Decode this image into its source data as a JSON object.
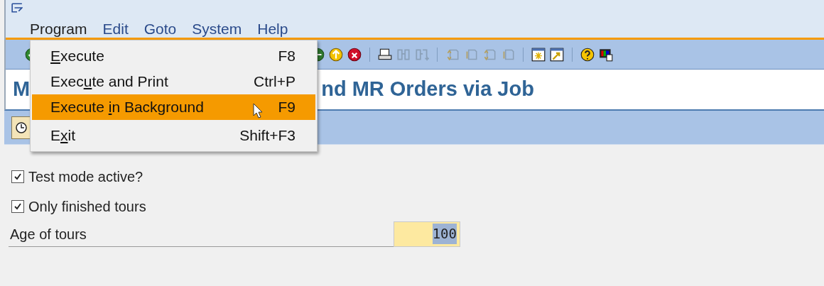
{
  "menubar": [
    {
      "label": "Program",
      "selected": true
    },
    {
      "label": "Edit",
      "selected": false
    },
    {
      "label": "Goto",
      "selected": false
    },
    {
      "label": "System",
      "selected": false
    },
    {
      "label": "Help",
      "selected": false
    }
  ],
  "menu": [
    {
      "key": "E",
      "post": "xecute",
      "shortcut": "F8",
      "selected": false
    },
    {
      "pre": "Exec",
      "key": "u",
      "post": "te and Print",
      "shortcut": "Ctrl+P",
      "selected": false
    },
    {
      "pre": "Execute ",
      "key": "i",
      "post": "n Background",
      "shortcut": "F9",
      "selected": true
    },
    {
      "pre": "E",
      "key": "x",
      "post": "it",
      "shortcut": "Shift+F3",
      "selected": false
    }
  ],
  "title": {
    "visible_start": "M",
    "visible_end": "nd MR Orders via Job"
  },
  "options": [
    {
      "label": "Test mode active?",
      "checked": true
    },
    {
      "label": "Only finished tours",
      "checked": true
    }
  ],
  "age_field": {
    "label": "Age of tours",
    "value": "100",
    "selected": true
  }
}
